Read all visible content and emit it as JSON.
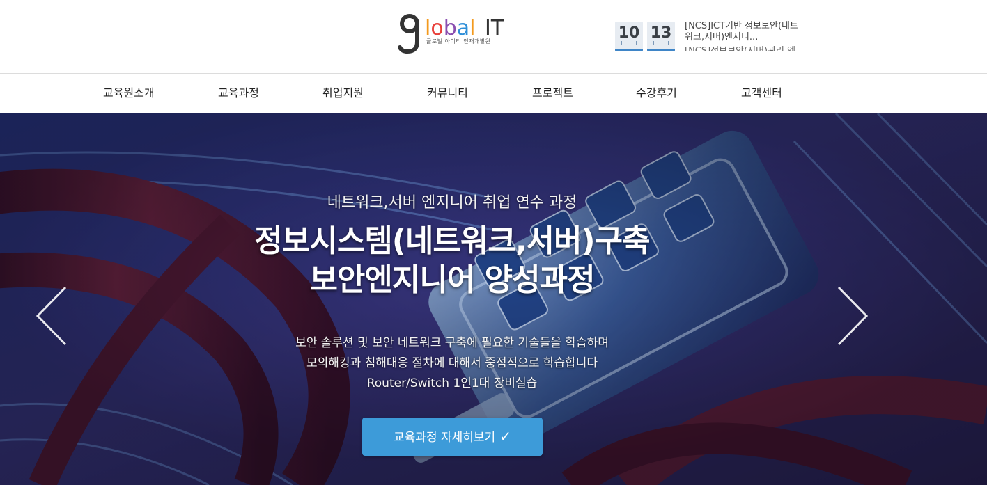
{
  "header": {
    "logo": {
      "text_g": "g",
      "text_lobal": "lobal",
      "text_it": "IT",
      "tagline": "글로벌 아이티 인재개발원"
    },
    "date": {
      "month": "10",
      "day": "13"
    },
    "notice": {
      "current": "[NCS]ICT기반 정보보안(네트워크,서버)엔지니...",
      "next": "[NCS]정보보안(서버)관리 엔지..."
    }
  },
  "nav": {
    "items": [
      "교육원소개",
      "교육과정",
      "취업지원",
      "커뮤니티",
      "프로젝트",
      "수강후기",
      "고객센터"
    ]
  },
  "hero": {
    "subtitle": "네트워크,서버 엔지니어 취업 연수 과정",
    "title_line1": "정보시스템(네트워크,서버)구축",
    "title_line2": "보안엔지니어 양성과정",
    "desc_line1": "보안 솔루션 및 보안 네트워크 구축에 필요한 기술들을 학습하며",
    "desc_line2": "모의해킹과 침해대응 절차에 대해서 중점적으로 학습합니다",
    "desc_line3": "Router/Switch 1인1대 장비실습",
    "cta_label": "교육과정 자세히보기",
    "cta_icon": "check-icon"
  },
  "colors": {
    "accent": "#3d9bd9",
    "date_bar": "#3f85c7",
    "logo_orange": "#f39a1e",
    "logo_red": "#e8403a",
    "logo_purple": "#8a4fb0",
    "logo_blue": "#2f8fd8",
    "logo_dark": "#333333"
  }
}
